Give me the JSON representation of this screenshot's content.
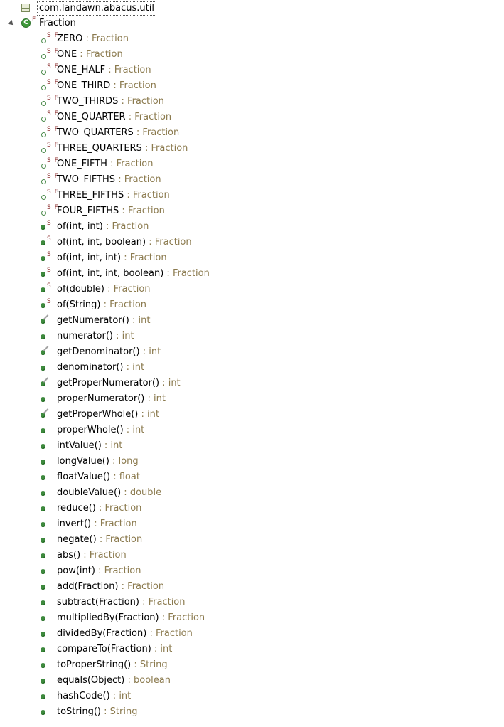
{
  "package": {
    "label": "com.landawn.abacus.util"
  },
  "class": {
    "label": "Fraction",
    "modifier": "F"
  },
  "members": [
    {
      "kind": "field",
      "mod": "S F",
      "name": "ZERO",
      "type": "Fraction"
    },
    {
      "kind": "field",
      "mod": "S F",
      "name": "ONE",
      "type": "Fraction"
    },
    {
      "kind": "field",
      "mod": "S F",
      "name": "ONE_HALF",
      "type": "Fraction"
    },
    {
      "kind": "field",
      "mod": "S F",
      "name": "ONE_THIRD",
      "type": "Fraction"
    },
    {
      "kind": "field",
      "mod": "S F",
      "name": "TWO_THIRDS",
      "type": "Fraction"
    },
    {
      "kind": "field",
      "mod": "S F",
      "name": "ONE_QUARTER",
      "type": "Fraction"
    },
    {
      "kind": "field",
      "mod": "S F",
      "name": "TWO_QUARTERS",
      "type": "Fraction"
    },
    {
      "kind": "field",
      "mod": "S F",
      "name": "THREE_QUARTERS",
      "type": "Fraction"
    },
    {
      "kind": "field",
      "mod": "S F",
      "name": "ONE_FIFTH",
      "type": "Fraction"
    },
    {
      "kind": "field",
      "mod": "S F",
      "name": "TWO_FIFTHS",
      "type": "Fraction"
    },
    {
      "kind": "field",
      "mod": "S F",
      "name": "THREE_FIFTHS",
      "type": "Fraction"
    },
    {
      "kind": "field",
      "mod": "S F",
      "name": "FOUR_FIFTHS",
      "type": "Fraction"
    },
    {
      "kind": "method",
      "mod": "S",
      "name": "of(int, int)",
      "type": "Fraction"
    },
    {
      "kind": "method",
      "mod": "S",
      "name": "of(int, int, boolean)",
      "type": "Fraction"
    },
    {
      "kind": "method",
      "mod": "S",
      "name": "of(int, int, int)",
      "type": "Fraction"
    },
    {
      "kind": "method",
      "mod": "S",
      "name": "of(int, int, int, boolean)",
      "type": "Fraction"
    },
    {
      "kind": "method",
      "mod": "S",
      "name": "of(double)",
      "type": "Fraction"
    },
    {
      "kind": "method",
      "mod": "S",
      "name": "of(String)",
      "type": "Fraction"
    },
    {
      "kind": "deprecated",
      "mod": "",
      "name": "getNumerator()",
      "type": "int"
    },
    {
      "kind": "method",
      "mod": "",
      "name": "numerator()",
      "type": "int"
    },
    {
      "kind": "deprecated",
      "mod": "",
      "name": "getDenominator()",
      "type": "int"
    },
    {
      "kind": "method",
      "mod": "",
      "name": "denominator()",
      "type": "int"
    },
    {
      "kind": "deprecated",
      "mod": "",
      "name": "getProperNumerator()",
      "type": "int"
    },
    {
      "kind": "method",
      "mod": "",
      "name": "properNumerator()",
      "type": "int"
    },
    {
      "kind": "deprecated",
      "mod": "",
      "name": "getProperWhole()",
      "type": "int"
    },
    {
      "kind": "method",
      "mod": "",
      "name": "properWhole()",
      "type": "int"
    },
    {
      "kind": "method",
      "mod": "",
      "name": "intValue()",
      "type": "int"
    },
    {
      "kind": "method",
      "mod": "",
      "name": "longValue()",
      "type": "long"
    },
    {
      "kind": "method",
      "mod": "",
      "name": "floatValue()",
      "type": "float"
    },
    {
      "kind": "method",
      "mod": "",
      "name": "doubleValue()",
      "type": "double"
    },
    {
      "kind": "method",
      "mod": "",
      "name": "reduce()",
      "type": "Fraction"
    },
    {
      "kind": "method",
      "mod": "",
      "name": "invert()",
      "type": "Fraction"
    },
    {
      "kind": "method",
      "mod": "",
      "name": "negate()",
      "type": "Fraction"
    },
    {
      "kind": "method",
      "mod": "",
      "name": "abs()",
      "type": "Fraction"
    },
    {
      "kind": "method",
      "mod": "",
      "name": "pow(int)",
      "type": "Fraction"
    },
    {
      "kind": "method",
      "mod": "",
      "name": "add(Fraction)",
      "type": "Fraction"
    },
    {
      "kind": "method",
      "mod": "",
      "name": "subtract(Fraction)",
      "type": "Fraction"
    },
    {
      "kind": "method",
      "mod": "",
      "name": "multipliedBy(Fraction)",
      "type": "Fraction"
    },
    {
      "kind": "method",
      "mod": "",
      "name": "dividedBy(Fraction)",
      "type": "Fraction"
    },
    {
      "kind": "method",
      "mod": "",
      "name": "compareTo(Fraction)",
      "type": "int"
    },
    {
      "kind": "method",
      "mod": "",
      "name": "toProperString()",
      "type": "String"
    },
    {
      "kind": "method",
      "mod": "",
      "name": "equals(Object)",
      "type": "boolean"
    },
    {
      "kind": "method",
      "mod": "",
      "name": "hashCode()",
      "type": "int"
    },
    {
      "kind": "method",
      "mod": "",
      "name": "toString()",
      "type": "String"
    }
  ]
}
